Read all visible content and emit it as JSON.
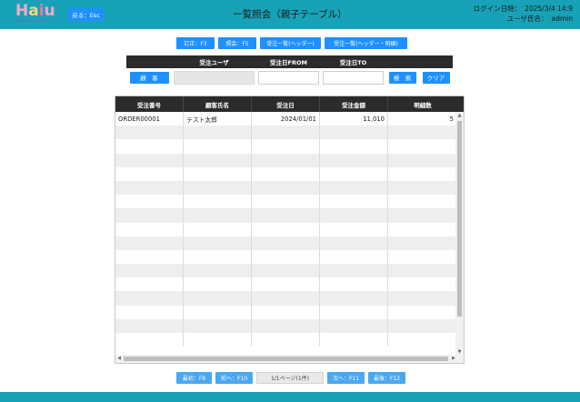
{
  "header": {
    "logo_text": "Haiu",
    "logo_sub": "Business Office",
    "back_label": "戻る：Esc",
    "title": "一覧照会（親子テーブル）",
    "login_label": "ログイン日時：",
    "login_value": "2025/3/4 14:9",
    "user_label": "ユーザ氏名：",
    "user_value": "admin"
  },
  "toolbar": {
    "buttons": [
      "訂正：F3",
      "照会：F5",
      "受注一覧(ヘッダー)",
      "受注一覧(ヘッダー・明細)"
    ]
  },
  "search": {
    "headers": [
      "",
      "受注ユーザ",
      "受注日FROM",
      "受注日TO",
      "",
      ""
    ],
    "customer_button": "顧　客",
    "user_value": "",
    "from_value": "",
    "to_value": "",
    "search_button": "検　索",
    "clear_button": "クリア"
  },
  "grid": {
    "columns": [
      "受注番号",
      "顧客氏名",
      "受注日",
      "受注金額",
      "明細数"
    ],
    "rows": [
      [
        "ORDER00001",
        "テスト太郎",
        "2024/01/01",
        "11,010",
        "5"
      ]
    ],
    "empty_rows": 16
  },
  "pager": {
    "first": "最初：F8",
    "prev": "前へ：F10",
    "info": "1/1ページ(1件)",
    "next": "次へ：F11",
    "last": "最後：F12"
  },
  "colors": {
    "header_bg": "#17a2b8",
    "button_bg": "#1e90ff",
    "table_header_bg": "#2b2b2b"
  }
}
